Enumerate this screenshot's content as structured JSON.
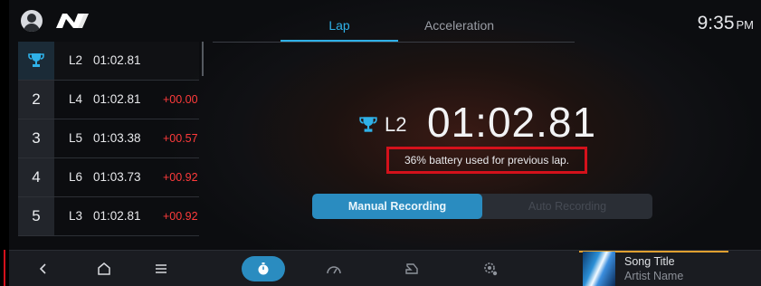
{
  "header": {
    "tabs": [
      {
        "label": "Lap",
        "active": true
      },
      {
        "label": "Acceleration",
        "active": false
      }
    ],
    "clock": {
      "time": "9:35",
      "ampm": "PM"
    }
  },
  "ranking": {
    "items": [
      {
        "rank": "",
        "icon": "trophy-icon",
        "lap": "L2",
        "time": "01:02.81",
        "diff": ""
      },
      {
        "rank": "2",
        "lap": "L4",
        "time": "01:02.81",
        "diff": "+00.00"
      },
      {
        "rank": "3",
        "lap": "L5",
        "time": "01:03.38",
        "diff": "+00.57"
      },
      {
        "rank": "4",
        "lap": "L6",
        "time": "01:03.73",
        "diff": "+00.92"
      },
      {
        "rank": "5",
        "lap": "L3",
        "time": "01:02.81",
        "diff": "+00.92"
      }
    ]
  },
  "best_lap": {
    "lap": "L2",
    "time": "01:02.81",
    "battery_note": "36% battery used for previous lap."
  },
  "recording": {
    "manual_label": "Manual Recording",
    "auto_label": "Auto Recording",
    "selected": "manual"
  },
  "media": {
    "title": "Song Title",
    "artist": "Artist Name"
  },
  "colors": {
    "accent": "#2a8cc0",
    "tab_active": "#2fb1e8",
    "diff_red": "#ff3b3b",
    "highlight_box": "#d4111b",
    "trophy": "#2fb1e8"
  }
}
